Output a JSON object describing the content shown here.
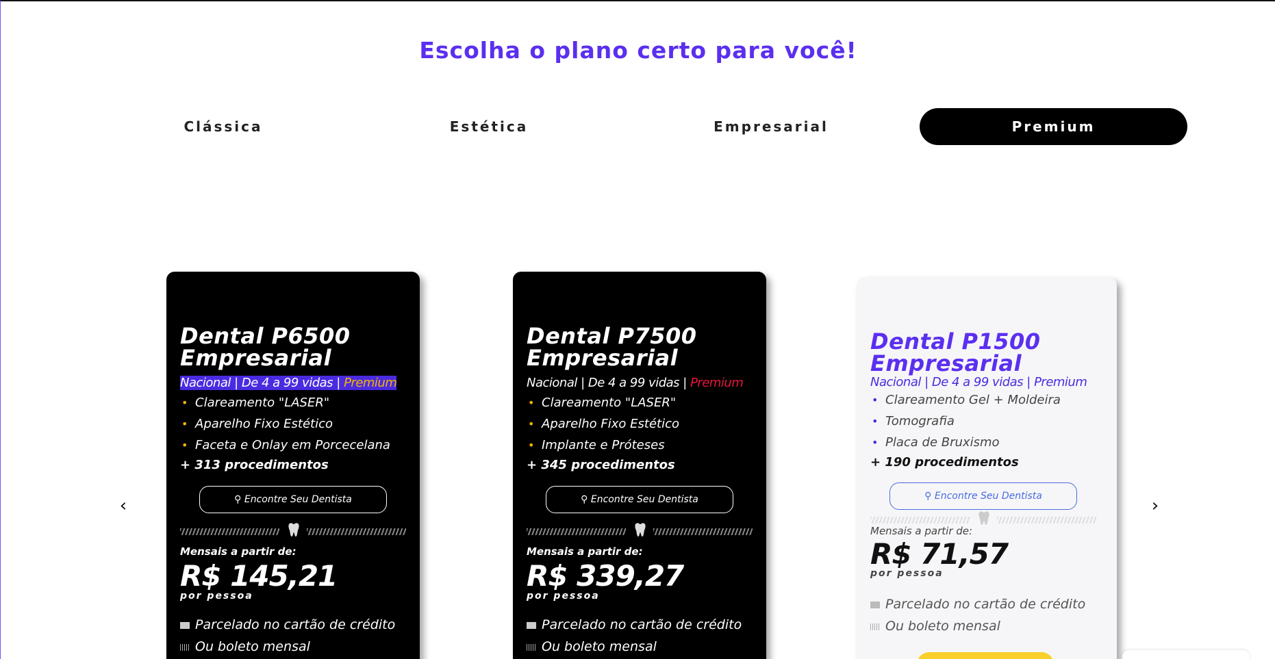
{
  "heading": "Escolha o plano certo para você!",
  "tabs": [
    {
      "label": "Clássica"
    },
    {
      "label": "Estética"
    },
    {
      "label": "Empresarial"
    },
    {
      "label": "Premium"
    }
  ],
  "active_tab": "Premium",
  "carousel": {
    "prev_icon": "chevron-left-icon",
    "next_icon": "chevron-right-icon",
    "prev_glyph": "‹",
    "next_glyph": "›"
  },
  "cards": [
    {
      "name_line1": "Dental P6500",
      "name_line2": "Empresarial",
      "sub_main": "Nacional | De 4 a 99 vidas | ",
      "sub_tag": "Premium",
      "features": [
        "Clareamento \"LASER\"",
        "Aparelho Fixo Estético",
        "Faceta e Onlay em Porcecelana"
      ],
      "procedures": "+ 313 procedimentos",
      "find_button": "Encontre Seu Dentista",
      "monthly_label": "Mensais a partir de:",
      "price": "R$ 145,21",
      "per_person": "por pessoa",
      "payment_card": "Parcelado no cartão de crédito",
      "payment_boleto": "Ou boleto mensal",
      "theme": "dark"
    },
    {
      "name_line1": "Dental P7500",
      "name_line2": "Empresarial",
      "sub_main": "Nacional | De 4 a 99 vidas | ",
      "sub_tag": "Premium",
      "features": [
        "Clareamento \"LASER\"",
        "Aparelho Fixo Estético",
        "Implante e Próteses"
      ],
      "procedures": "+ 345 procedimentos",
      "find_button": "Encontre Seu Dentista",
      "monthly_label": "Mensais a partir de:",
      "price": "R$ 339,27",
      "per_person": "por pessoa",
      "payment_card": "Parcelado no cartão de crédito",
      "payment_boleto": "Ou boleto mensal",
      "theme": "dark"
    },
    {
      "name_line1": "Dental P1500",
      "name_line2": "Empresarial",
      "sub_main": "Nacional | De 4 a 99 vidas | ",
      "sub_tag": "Premium",
      "features": [
        "Clareamento Gel + Moldeira",
        "Tomografia",
        "Placa de Bruxismo"
      ],
      "procedures": "+ 190 procedimentos",
      "find_button": "Encontre Seu Dentista",
      "monthly_label": "Mensais a partir de:",
      "price": "R$ 71,57",
      "per_person": "por pessoa",
      "payment_card": "Parcelado no cartão de crédito",
      "payment_boleto": "Ou boleto mensal",
      "theme": "light"
    }
  ],
  "colors": {
    "brand_purple": "#5b2ff0",
    "highlight_blue": "#4a2be0",
    "gold": "#f5b400",
    "red": "#e8143c",
    "cta_yellow": "#f9cf2a"
  }
}
